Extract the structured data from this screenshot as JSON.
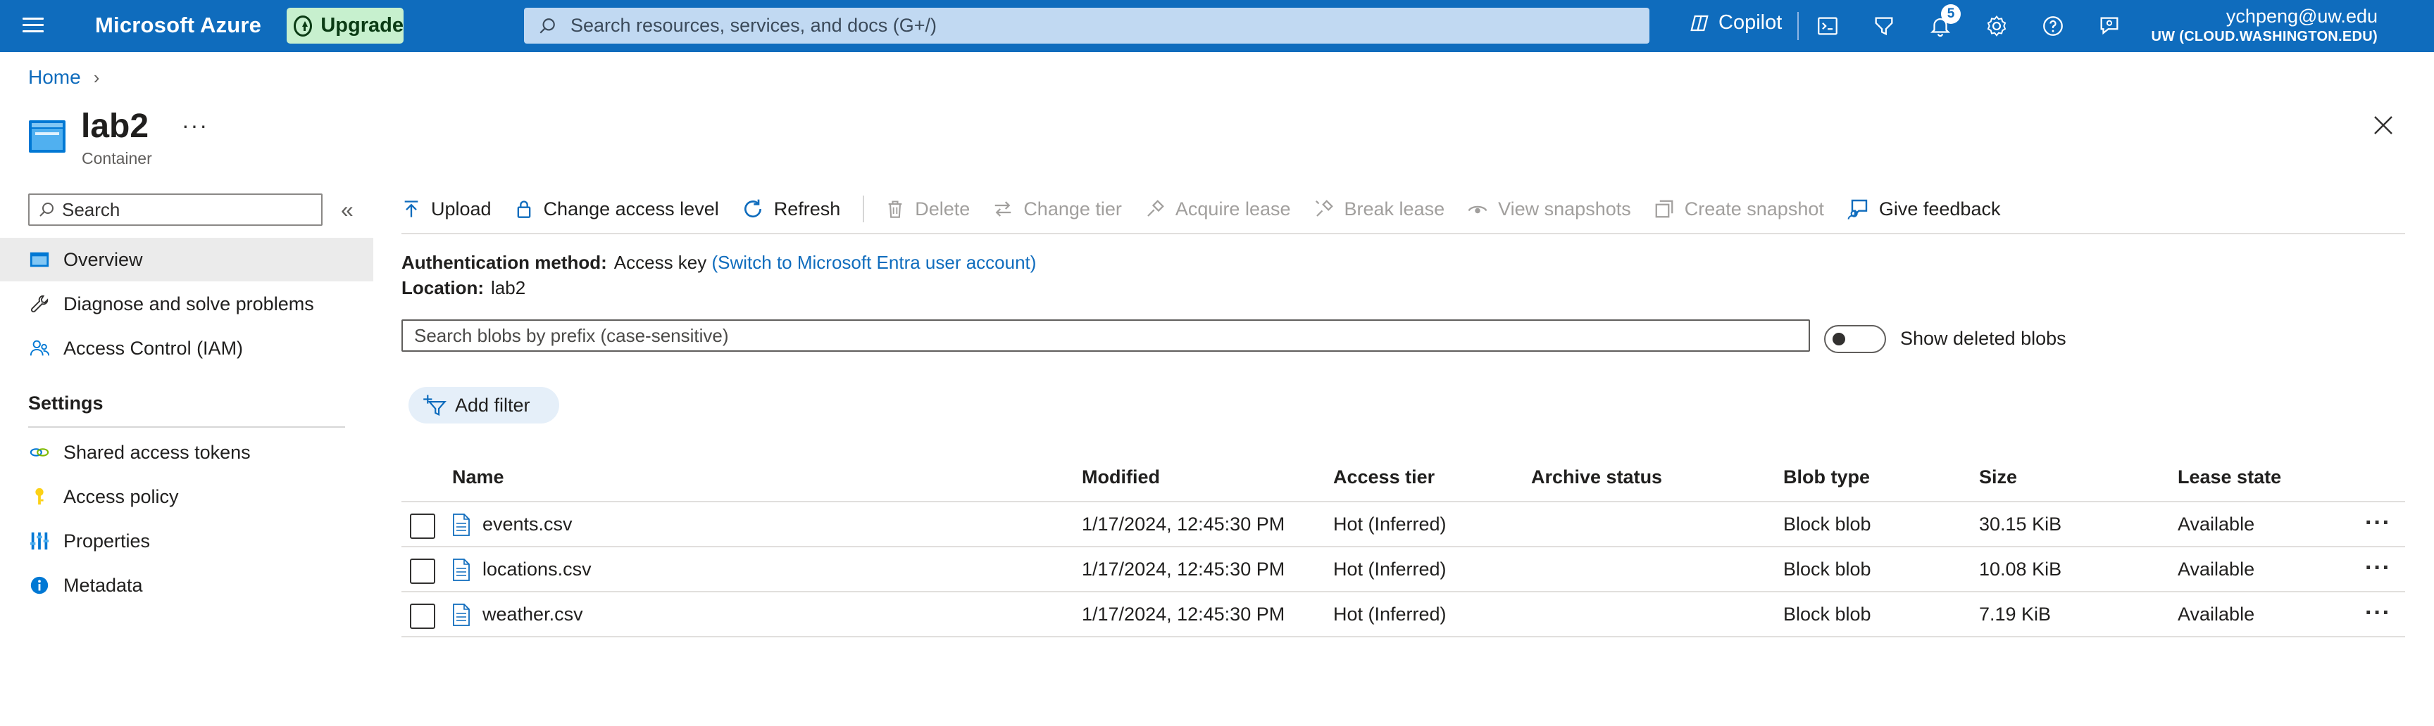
{
  "topbar": {
    "brand": "Microsoft Azure",
    "upgrade_label": "Upgrade",
    "search_placeholder": "Search resources, services, and docs (G+/)",
    "copilot_label": "Copilot",
    "notification_count": "5",
    "user_email": "ychpeng@uw.edu",
    "user_tenant": "UW (CLOUD.WASHINGTON.EDU)"
  },
  "breadcrumb": {
    "home": "Home"
  },
  "resource": {
    "title": "lab2",
    "subtitle": "Container",
    "more": "···"
  },
  "nav": {
    "search_placeholder": "Search",
    "collapse": "«",
    "items": [
      {
        "label": "Overview",
        "icon": "overview-icon",
        "active": true
      },
      {
        "label": "Diagnose and solve problems",
        "icon": "wrench-icon"
      },
      {
        "label": "Access Control (IAM)",
        "icon": "people-icon"
      }
    ],
    "section_title": "Settings",
    "settings_items": [
      {
        "label": "Shared access tokens",
        "icon": "link-icon"
      },
      {
        "label": "Access policy",
        "icon": "key-icon"
      },
      {
        "label": "Properties",
        "icon": "properties-icon"
      },
      {
        "label": "Metadata",
        "icon": "info-icon"
      }
    ]
  },
  "commands": {
    "upload": "Upload",
    "change_access": "Change access level",
    "refresh": "Refresh",
    "delete": "Delete",
    "change_tier": "Change tier",
    "acquire_lease": "Acquire lease",
    "break_lease": "Break lease",
    "view_snapshots": "View snapshots",
    "create_snapshot": "Create snapshot",
    "give_feedback": "Give feedback"
  },
  "info": {
    "auth_label": "Authentication method:",
    "auth_value": "Access key",
    "auth_link": "(Switch to Microsoft Entra user account)",
    "location_label": "Location:",
    "location_value": "lab2"
  },
  "blobs": {
    "search_placeholder": "Search blobs by prefix (case-sensitive)",
    "show_deleted_label": "Show deleted blobs",
    "show_deleted": false,
    "add_filter": "Add filter",
    "columns": [
      "Name",
      "Modified",
      "Access tier",
      "Archive status",
      "Blob type",
      "Size",
      "Lease state"
    ],
    "rows": [
      {
        "name": "events.csv",
        "modified": "1/17/2024, 12:45:30 PM",
        "tier": "Hot (Inferred)",
        "archive": "",
        "type": "Block blob",
        "size": "30.15 KiB",
        "lease": "Available"
      },
      {
        "name": "locations.csv",
        "modified": "1/17/2024, 12:45:30 PM",
        "tier": "Hot (Inferred)",
        "archive": "",
        "type": "Block blob",
        "size": "10.08 KiB",
        "lease": "Available"
      },
      {
        "name": "weather.csv",
        "modified": "1/17/2024, 12:45:30 PM",
        "tier": "Hot (Inferred)",
        "archive": "",
        "type": "Block blob",
        "size": "7.19 KiB",
        "lease": "Available"
      }
    ],
    "row_more": "···"
  },
  "colors": {
    "accent": "#0f6cbd",
    "upgrade_bg": "#c7f0ce",
    "search_bg": "#c1d9f2"
  }
}
